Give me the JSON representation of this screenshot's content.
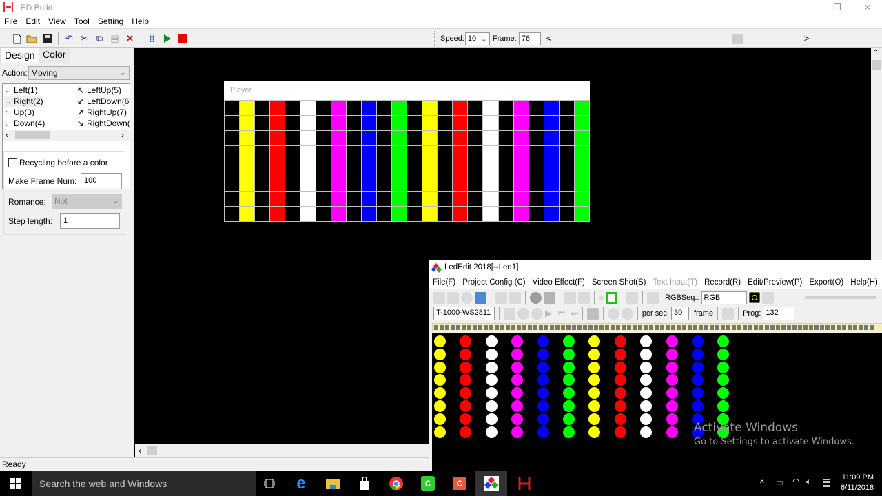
{
  "window": {
    "title": "LED Build",
    "minimize_icon": "minimize-icon",
    "restore_icon": "restore-icon",
    "close_icon": "close-icon"
  },
  "menu": [
    "File",
    "Edit",
    "View",
    "Tool",
    "Setting",
    "Help"
  ],
  "toolbar": {
    "icons": [
      "new-file-icon",
      "open-folder-icon",
      "save-icon",
      "undo-icon",
      "cut-icon",
      "copy-icon",
      "paste-icon",
      "delete-icon",
      "grid-icon",
      "play-icon",
      "stop-icon"
    ],
    "speed_label": "Speed:",
    "speed_value": "10",
    "frame_label": "Frame:",
    "frame_value": "76",
    "scroll_left": "<",
    "scroll_right": ">"
  },
  "left_panel": {
    "tabs": [
      "Design",
      "Color"
    ],
    "action_label": "Action:",
    "action_value": "Moving",
    "directions": [
      {
        "arrow": "←",
        "label": "Left(1)"
      },
      {
        "arrow": "→",
        "label": "Right(2)"
      },
      {
        "arrow": "↑",
        "label": "Up(3)"
      },
      {
        "arrow": "↓",
        "label": "Down(4)"
      },
      {
        "arrow": "↖",
        "label": "LeftUp(5)"
      },
      {
        "arrow": "↙",
        "label": "LeftDown(6)"
      },
      {
        "arrow": "↗",
        "label": "RightUp(7)"
      },
      {
        "arrow": "↘",
        "label": "RightDown(8)"
      }
    ],
    "recycling_label": "Recycling before a color",
    "recycling_checked": false,
    "make_frame_label": "Make Frame Num:",
    "make_frame_value": "100",
    "romance_label": "Romance:",
    "romance_value": "Not",
    "step_label": "Step length:",
    "step_value": "1"
  },
  "player": {
    "title": "Player",
    "rows": 8,
    "columns": [
      "#000000",
      "#ffff00",
      "#000000",
      "#ff0000",
      "#000000",
      "#ffffff",
      "#000000",
      "#ff00ff",
      "#000000",
      "#0000ff",
      "#000000",
      "#00ff00",
      "#000000",
      "#ffff00",
      "#000000",
      "#ff0000",
      "#000000",
      "#ffffff",
      "#000000",
      "#ff00ff",
      "#000000",
      "#0000ff",
      "#000000",
      "#00ff00"
    ]
  },
  "status": "Ready",
  "ledit": {
    "title": "LedEdit 2018[--Led1]",
    "menu": [
      "File(F)",
      "Project Config (C)",
      "Video Effect(F)",
      "Screen Shot(S)",
      "Text Input(T)",
      "Record(R)",
      "Edit/Preview(P)",
      "Export(O)",
      "Help(H)"
    ],
    "rgbseq_label": "RGBSeq.:",
    "rgbseq_value": "RGB",
    "controller": "T-1000-WS2811",
    "per_sec_label": "per sec.",
    "per_sec_value": "30",
    "frame_label": "frame",
    "prog_label": "Prog:",
    "prog_value": "132",
    "led_rows": 8,
    "led_columns": [
      "#ffff00",
      "#ff0000",
      "#ffffff",
      "#ff00ff",
      "#0000ff",
      "#00ff00",
      "#ffff00",
      "#ff0000",
      "#ffffff",
      "#ff00ff",
      "#0000ff",
      "#00ff00"
    ]
  },
  "watermark": {
    "line1": "Activate Windows",
    "line2": "Go to Settings to activate Windows."
  },
  "taskbar": {
    "search_placeholder": "Search the web and Windows",
    "time": "11:09 PM",
    "date": "6/11/2018"
  }
}
